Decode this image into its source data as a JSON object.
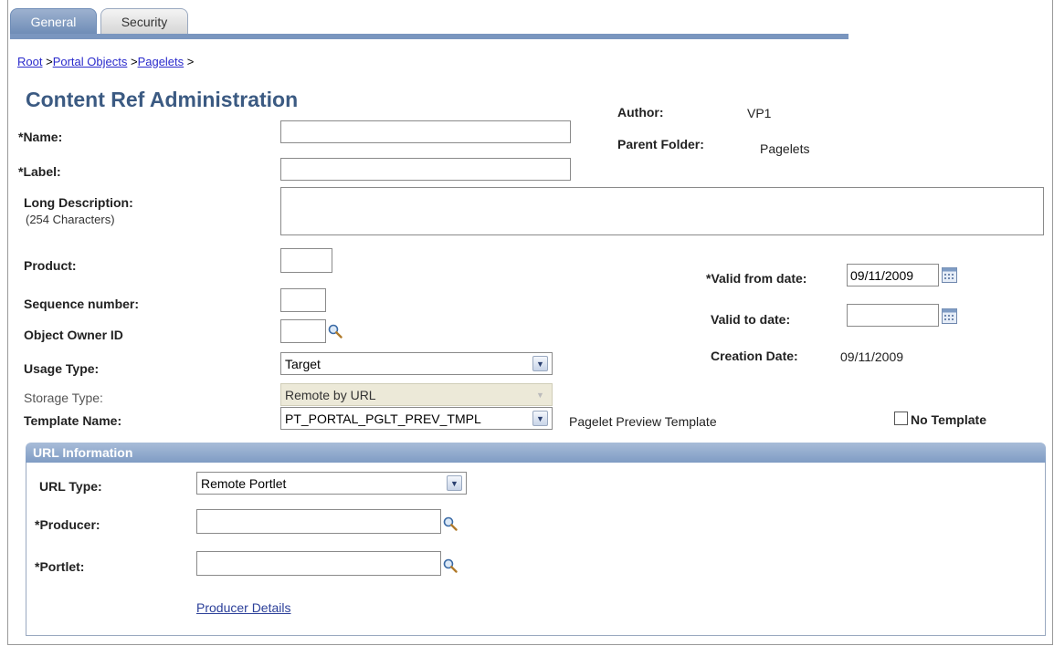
{
  "tabs": [
    {
      "label": "General"
    },
    {
      "label": "Security"
    }
  ],
  "breadcrumb": {
    "root": "Root",
    "portal_objects": "Portal Objects",
    "pagelets": "Pagelets",
    "sep": " >"
  },
  "page": {
    "title": "Content Ref Administration"
  },
  "meta": {
    "author_label": "Author:",
    "author_value": "VP1",
    "parent_folder_label": "Parent Folder:",
    "parent_folder_value": "Pagelets"
  },
  "form": {
    "name_label": "*Name:",
    "name_value": "",
    "label_label": "*Label:",
    "label_value": "",
    "long_desc_label": "Long Description:",
    "long_desc_hint": "(254 Characters)",
    "long_desc_value": "",
    "product_label": "Product:",
    "product_value": "",
    "sequence_label": "Sequence number:",
    "sequence_value": "",
    "owner_label": "Object Owner ID",
    "owner_value": "",
    "usage_label": "Usage Type:",
    "usage_value": "Target",
    "storage_label": "Storage Type:",
    "storage_value": "Remote by URL",
    "template_label": "Template Name:",
    "template_value": "PT_PORTAL_PGLT_PREV_TMPL",
    "template_desc": "Pagelet Preview Template",
    "no_template_label": "No Template"
  },
  "dates": {
    "valid_from_label": "*Valid from date:",
    "valid_from_value": "09/11/2009",
    "valid_to_label": "Valid to date:",
    "valid_to_value": "",
    "creation_label": "Creation Date:",
    "creation_value": "09/11/2009"
  },
  "url_info": {
    "header": "URL Information",
    "url_type_label": "URL Type:",
    "url_type_value": "Remote Portlet",
    "producer_label": "*Producer:",
    "producer_value": "",
    "portlet_label": "*Portlet:",
    "portlet_value": "",
    "producer_details_link": "Producer Details"
  }
}
